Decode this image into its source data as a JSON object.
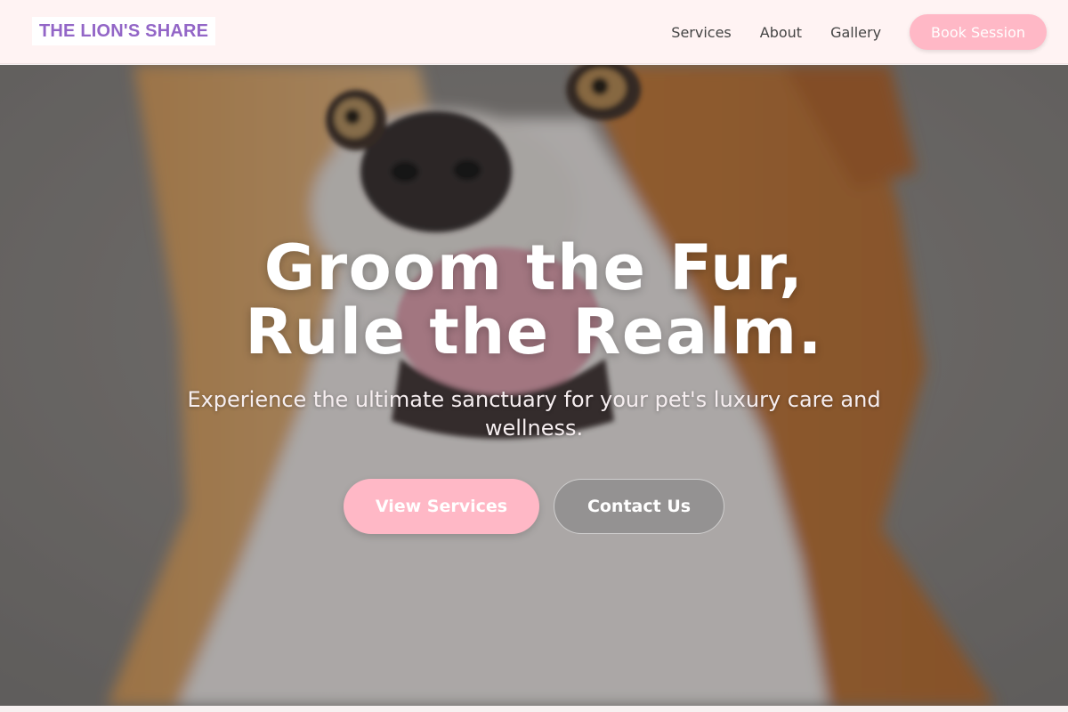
{
  "header": {
    "logo": "THE LION'S SHARE",
    "nav": [
      {
        "label": "Services"
      },
      {
        "label": "About"
      },
      {
        "label": "Gallery"
      }
    ],
    "cta": "Book Session"
  },
  "hero": {
    "headline_line1": "Groom the Fur,",
    "headline_line2": "Rule the Realm.",
    "subheadline": "Experience the ultimate sanctuary for your pet's luxury care and wellness.",
    "primary_button": "View Services",
    "secondary_button": "Contact Us",
    "image": "corgi-dog-closeup-photo"
  },
  "colors": {
    "accent_pink": "#ffb8c6",
    "logo_purple": "#9366c7",
    "header_bg": "#fff3f3",
    "nav_text": "#444444",
    "hero_text": "#ffffff"
  }
}
